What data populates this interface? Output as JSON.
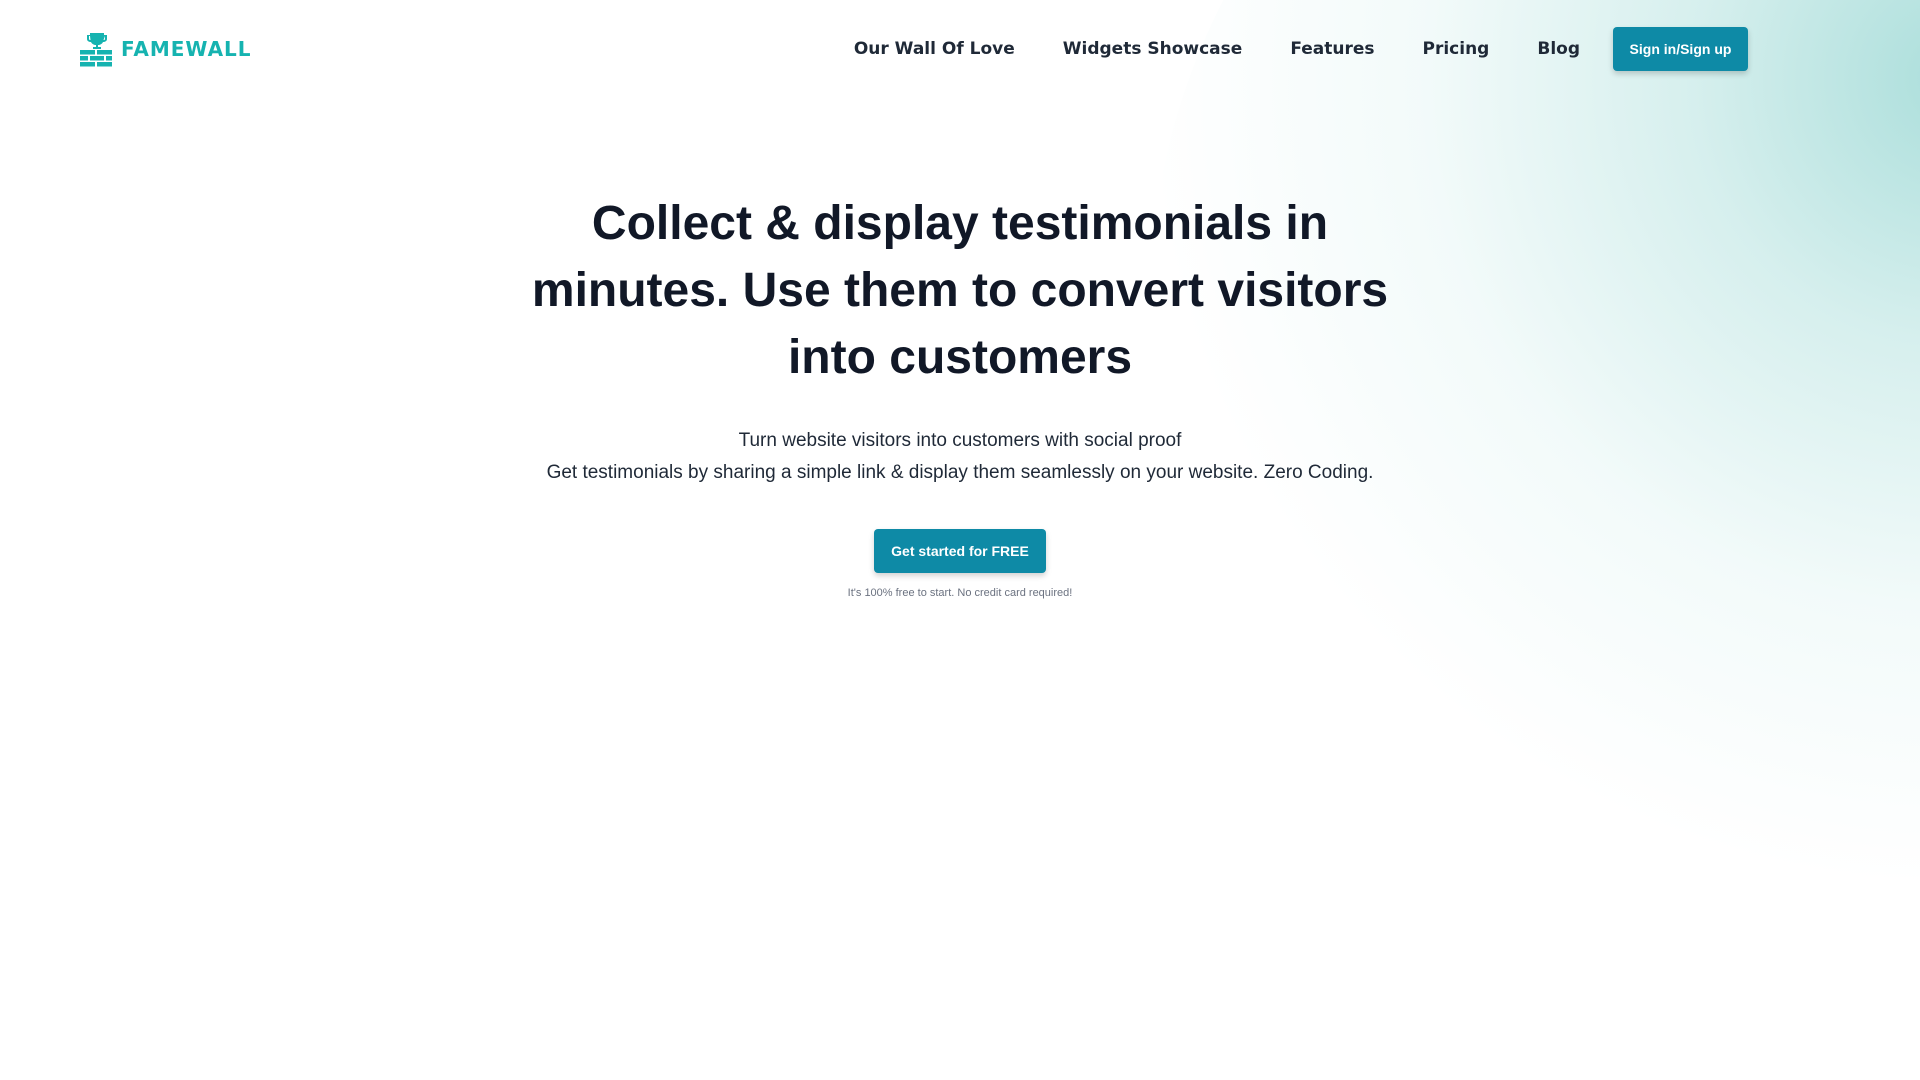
{
  "brand": {
    "name": "FAMEWALL",
    "logo_icon": "trophy-wall-icon",
    "color": "#16b3b0"
  },
  "nav": {
    "items": [
      {
        "label": "Our Wall Of Love"
      },
      {
        "label": "Widgets Showcase"
      },
      {
        "label": "Features"
      },
      {
        "label": "Pricing"
      },
      {
        "label": "Blog"
      }
    ],
    "signin_label": "Sign in/Sign up"
  },
  "hero": {
    "title": "Collect & display testimonials in minutes. Use them to convert visitors into customers",
    "subtitle_line1": "Turn website visitors into customers with social proof",
    "subtitle_line2": "Get testimonials by sharing a simple link & display them seamlessly on your website. Zero Coding.",
    "cta_label": "Get started for FREE",
    "cta_note": "It's 100% free to start. No credit card required!"
  },
  "colors": {
    "accent": "#0e8aa6",
    "brand": "#16b3b0",
    "glow": "#96d6d2"
  }
}
